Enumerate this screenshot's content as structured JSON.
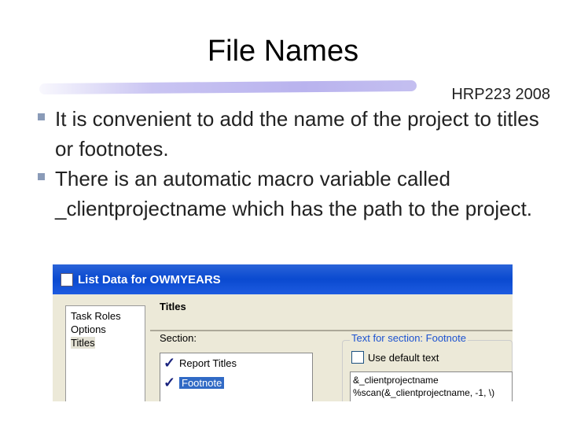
{
  "slide": {
    "title": "File Names",
    "course": "HRP223 2008",
    "bullets": [
      "It is convenient to add the name of the project to titles or footnotes.",
      "There is an automatic macro variable called _clientprojectname which has the path to the project."
    ]
  },
  "dialog": {
    "title": "List Data for OWMYEARS",
    "nav": [
      "Task Roles",
      "Options",
      "Titles"
    ],
    "heading": "Titles",
    "section_label": "Section:",
    "sections": [
      "Report Titles",
      "Footnote"
    ],
    "group_label": "Text for section: Footnote",
    "checkbox_label": "Use default text",
    "text_lines": [
      "&_clientprojectname",
      "%scan(&_clientprojectname, -1, \\)"
    ]
  }
}
